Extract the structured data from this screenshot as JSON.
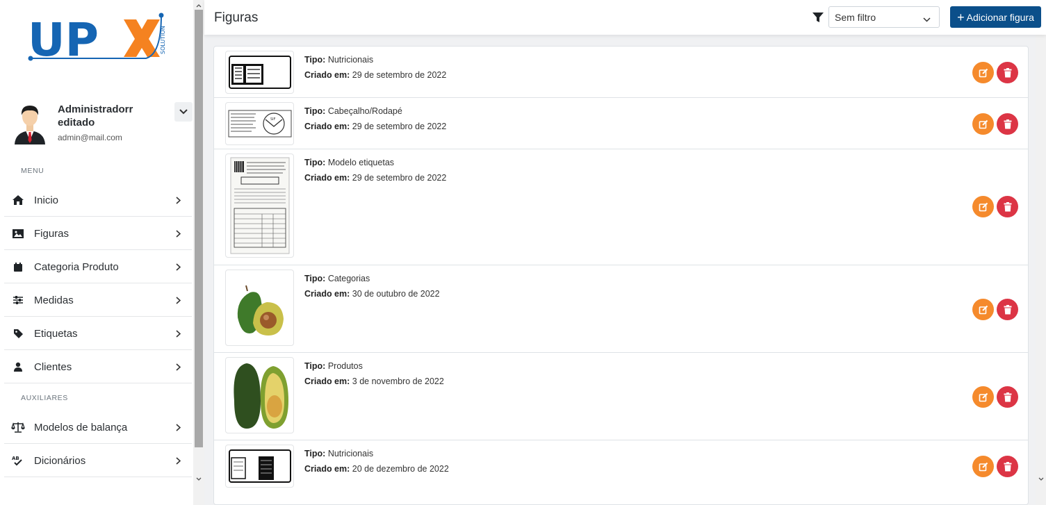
{
  "brand": {
    "logo_text": "UPX",
    "logo_sub": "SOLUTION"
  },
  "profile": {
    "name": "Administradorr editado",
    "email": "admin@mail.com"
  },
  "sidebar": {
    "menu_label": "MENU",
    "items": [
      {
        "label": "Inicio",
        "icon": "home-icon"
      },
      {
        "label": "Figuras",
        "icon": "image-icon"
      },
      {
        "label": "Categoria Produto",
        "icon": "calendar-icon"
      },
      {
        "label": "Medidas",
        "icon": "sliders-icon"
      },
      {
        "label": "Etiquetas",
        "icon": "tag-icon"
      },
      {
        "label": "Clientes",
        "icon": "user-icon"
      }
    ],
    "aux_label": "AUXILIARES",
    "aux_items": [
      {
        "label": "Modelos de balança",
        "icon": "scale-icon"
      },
      {
        "label": "Dicionários",
        "icon": "spellcheck-icon"
      }
    ]
  },
  "header": {
    "title": "Figuras",
    "filter": {
      "selected": "Sem filtro"
    },
    "add_button": {
      "label": "Adicionar figura",
      "icon": "plus-icon"
    }
  },
  "labels": {
    "type": "Tipo:",
    "created": "Criado em:"
  },
  "figures": [
    {
      "type": "Nutricionais",
      "created": "29 de setembro de 2022",
      "thumb": "label-strip"
    },
    {
      "type": "Cabeçalho/Rodapé",
      "created": "29 de setembro de 2022",
      "thumb": "header-footer"
    },
    {
      "type": "Modelo etiquetas",
      "created": "29 de setembro de 2022",
      "thumb": "label-model"
    },
    {
      "type": "Categorias",
      "created": "30 de outubro de 2022",
      "thumb": "avocado"
    },
    {
      "type": "Produtos",
      "created": "3 de novembro de 2022",
      "thumb": "avocado-large"
    },
    {
      "type": "Nutricionais",
      "created": "20 de dezembro de 2022",
      "thumb": "label-strip"
    }
  ],
  "colors": {
    "primary": "#0b4f8a",
    "edit": "#f58a2c",
    "delete": "#dc3545",
    "logo_blue": "#1565b3",
    "logo_orange": "#f58220"
  }
}
